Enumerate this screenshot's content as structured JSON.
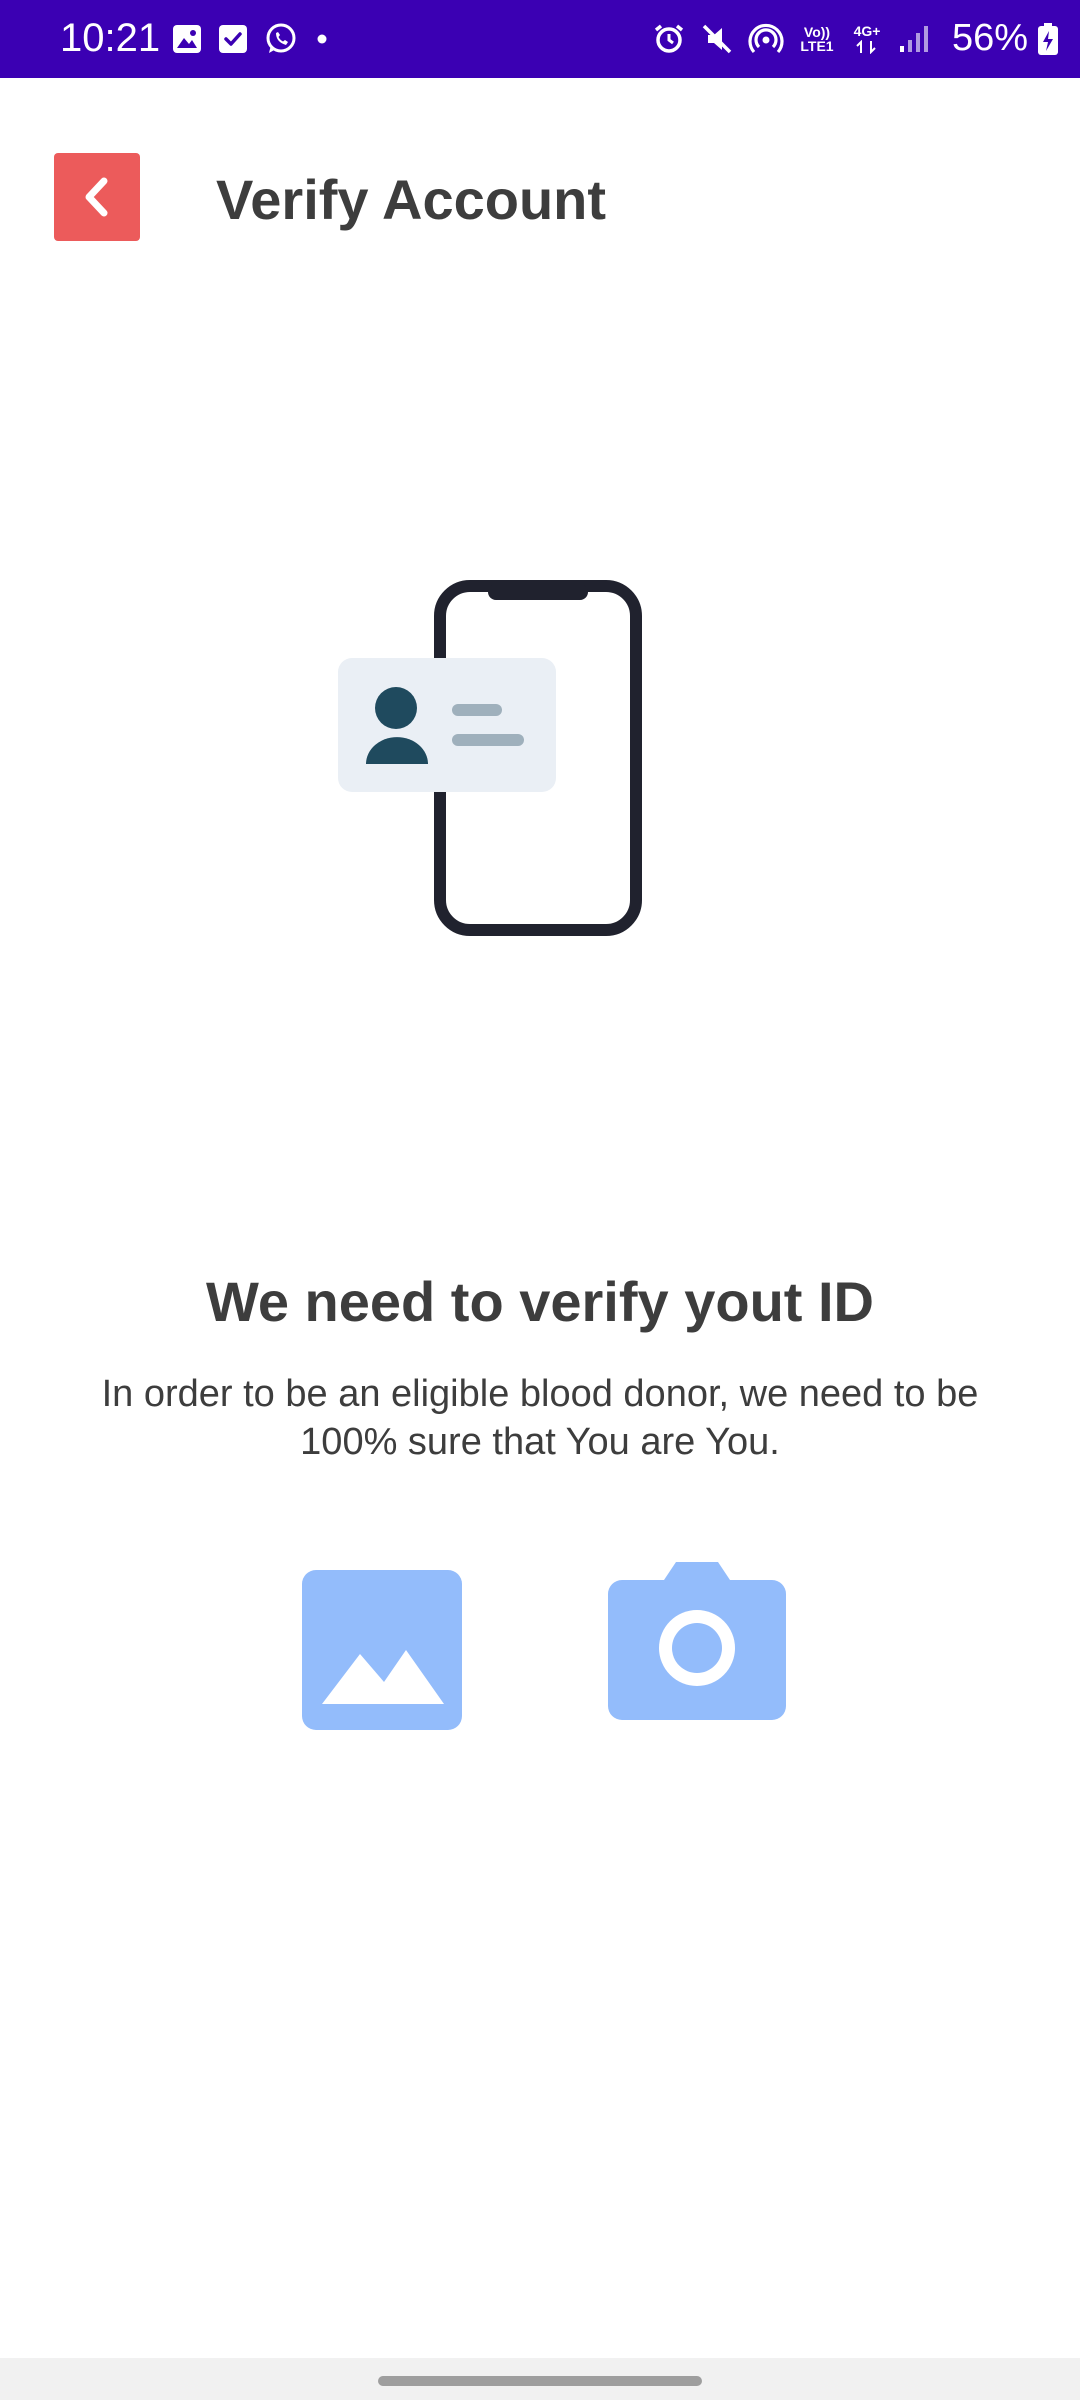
{
  "status_bar": {
    "time": "10:21",
    "battery": "56%",
    "network_top": "Vo))",
    "network_bottom": "LTE1",
    "network_type": "4G+",
    "background": "#3b00b3",
    "left_icons": [
      "gallery-icon",
      "checkbox-icon",
      "whatsapp-icon",
      "dot-icon"
    ],
    "right_icons": [
      "alarm-icon",
      "mute-icon",
      "hotspot-icon",
      "signal-icon",
      "battery-charging-icon"
    ]
  },
  "header": {
    "title": "Verify Account",
    "back_icon": "chevron-left-icon",
    "back_color": "#ec5b5b"
  },
  "illustration": {
    "icon": "id-card-phone-illustration"
  },
  "main": {
    "headline": "We need to verify yout ID",
    "description": "In order to be an eligible blood donor, we need to be 100% sure that You are You."
  },
  "actions": {
    "gallery_icon": "image-icon",
    "camera_icon": "camera-icon",
    "accent": "#93bcfb"
  }
}
